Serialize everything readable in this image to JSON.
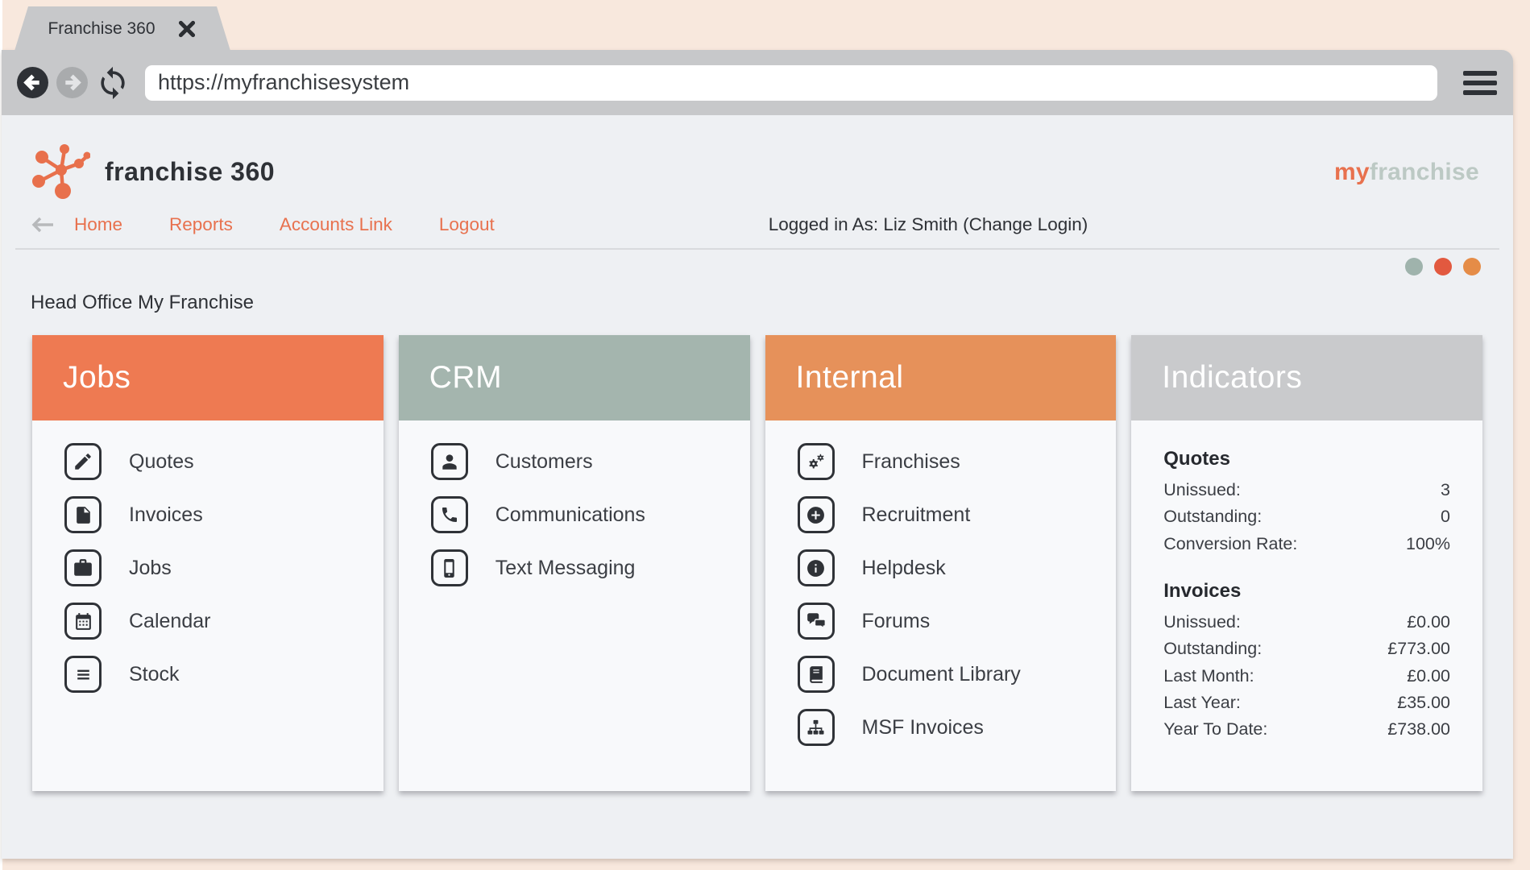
{
  "browser": {
    "tab_title": "Franchise 360",
    "url": "https://myfranchisesystem"
  },
  "header": {
    "brand": "franchise 360",
    "brand_right_my": "my",
    "brand_right_franchise": "franchise",
    "nav": {
      "home": "Home",
      "reports": "Reports",
      "accounts_link": "Accounts Link",
      "logout": "Logout"
    },
    "logged_in": "Logged in As: Liz Smith (Change Login)"
  },
  "page": {
    "heading": "Head Office My Franchise",
    "cards": [
      {
        "title": "Jobs",
        "header_color": "#ee7a52",
        "items": [
          {
            "label": "Quotes",
            "icon": "pencil-square-icon"
          },
          {
            "label": "Invoices",
            "icon": "file-icon"
          },
          {
            "label": "Jobs",
            "icon": "briefcase-icon"
          },
          {
            "label": "Calendar",
            "icon": "calendar-icon"
          },
          {
            "label": "Stock",
            "icon": "list-icon"
          }
        ]
      },
      {
        "title": "CRM",
        "header_color": "#a4b5ae",
        "items": [
          {
            "label": "Customers",
            "icon": "user-icon"
          },
          {
            "label": "Communications",
            "icon": "phone-icon"
          },
          {
            "label": "Text Messaging",
            "icon": "mobile-icon"
          }
        ]
      },
      {
        "title": "Internal",
        "header_color": "#e6915a",
        "items": [
          {
            "label": "Franchises",
            "icon": "cogs-icon"
          },
          {
            "label": "Recruitment",
            "icon": "plus-circle-icon"
          },
          {
            "label": "Helpdesk",
            "icon": "info-circle-icon"
          },
          {
            "label": "Forums",
            "icon": "comments-icon"
          },
          {
            "label": "Document Library",
            "icon": "book-icon"
          },
          {
            "label": "MSF Invoices",
            "icon": "sitemap-icon"
          }
        ]
      }
    ],
    "indicators": {
      "title": "Indicators",
      "header_color": "#c9cacc",
      "sections": [
        {
          "title": "Quotes",
          "rows": [
            {
              "label": "Unissued:",
              "value": "3"
            },
            {
              "label": "Outstanding:",
              "value": "0"
            },
            {
              "label": "Conversion Rate:",
              "value": "100%"
            }
          ]
        },
        {
          "title": "Invoices",
          "rows": [
            {
              "label": "Unissued:",
              "value": "£0.00"
            },
            {
              "label": "Outstanding:",
              "value": "£773.00"
            },
            {
              "label": "Last Month:",
              "value": "£0.00"
            },
            {
              "label": "Last Year:",
              "value": "£35.00"
            },
            {
              "label": "Year To Date:",
              "value": "£738.00"
            }
          ]
        }
      ]
    }
  },
  "colors": {
    "accent_orange": "#e8714e",
    "sage": "#a4b5ae",
    "dot_sage": "#9fb3ac",
    "dot_red": "#e2593f",
    "dot_orange": "#e58c47",
    "chrome_gray": "#c7c8ca",
    "outer_background": "#f8e8dd",
    "page_background": "#eef0f3"
  }
}
